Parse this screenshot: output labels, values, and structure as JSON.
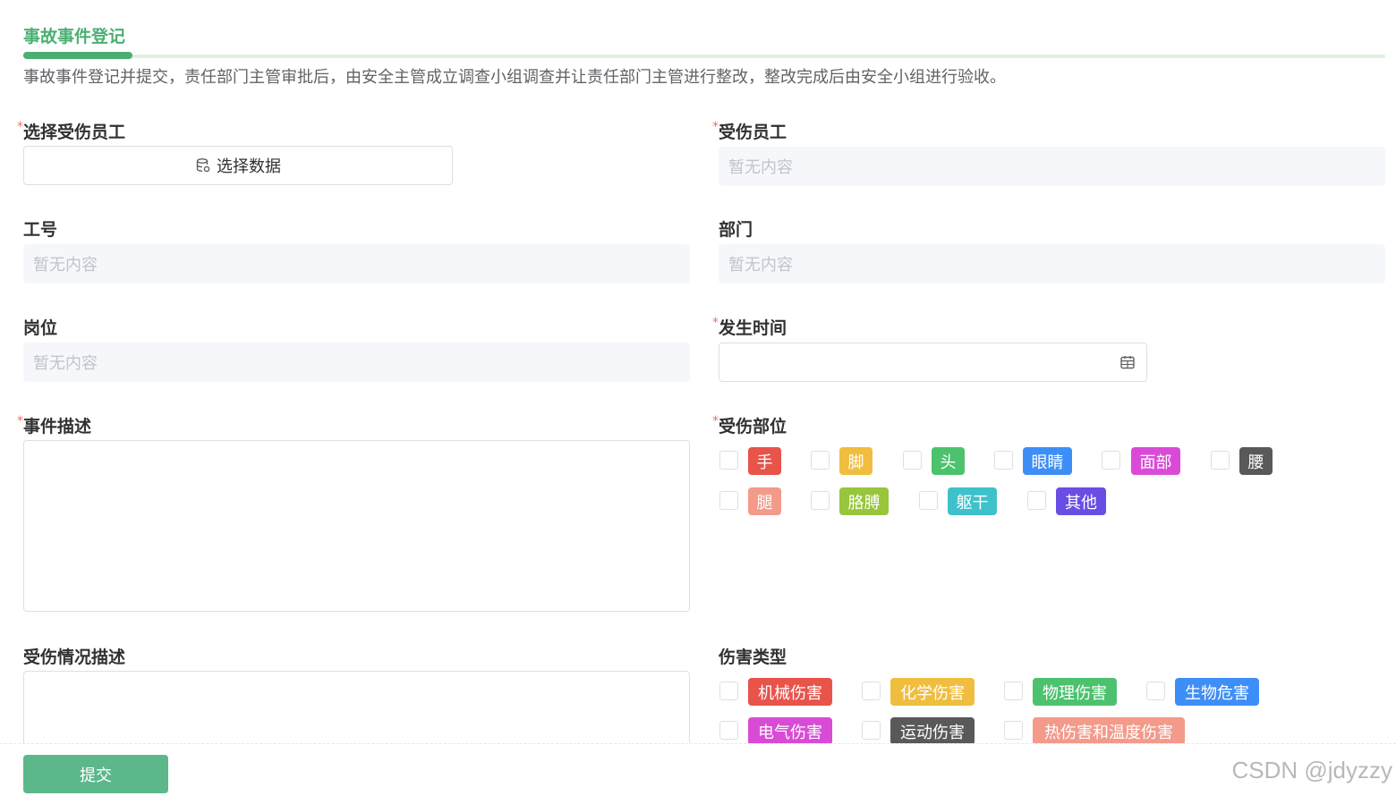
{
  "tab": {
    "title": "事故事件登记"
  },
  "intro": "事故事件登记并提交，责任部门主管审批后，由安全主管成立调查小组调查并让责任部门主管进行整改，整改完成后由安全小组进行验收。",
  "required_mark": "*",
  "fields": {
    "select_employee": {
      "label": "选择受伤员工",
      "button_label": "选择数据"
    },
    "injured_employee": {
      "label": "受伤员工",
      "value": "暂无内容"
    },
    "employee_no": {
      "label": "工号",
      "value": "暂无内容"
    },
    "department": {
      "label": "部门",
      "value": "暂无内容"
    },
    "position": {
      "label": "岗位",
      "value": "暂无内容"
    },
    "occur_time": {
      "label": "发生时间",
      "value": ""
    },
    "event_desc": {
      "label": "事件描述",
      "value": ""
    },
    "injury_part": {
      "label": "受伤部位",
      "options": [
        {
          "label": "手",
          "color": "#e8534a"
        },
        {
          "label": "脚",
          "color": "#f0bd3e"
        },
        {
          "label": "头",
          "color": "#4cc26e"
        },
        {
          "label": "眼睛",
          "color": "#3e8ef7"
        },
        {
          "label": "面部",
          "color": "#d94bd6"
        },
        {
          "label": "腰",
          "color": "#595959"
        },
        {
          "label": "腿",
          "color": "#f39a8a"
        },
        {
          "label": "胳膊",
          "color": "#97c53c"
        },
        {
          "label": "躯干",
          "color": "#3fc1cb"
        },
        {
          "label": "其他",
          "color": "#6a4de3"
        }
      ]
    },
    "injury_desc": {
      "label": "受伤情况描述",
      "value": ""
    },
    "harm_type": {
      "label": "伤害类型",
      "options": [
        {
          "label": "机械伤害",
          "color": "#e8534a"
        },
        {
          "label": "化学伤害",
          "color": "#f0bd3e"
        },
        {
          "label": "物理伤害",
          "color": "#4cc26e"
        },
        {
          "label": "生物危害",
          "color": "#3e8ef7"
        },
        {
          "label": "电气伤害",
          "color": "#d94bd6"
        },
        {
          "label": "运动伤害",
          "color": "#595959"
        },
        {
          "label": "热伤害和温度伤害",
          "color": "#f39a8a"
        }
      ]
    }
  },
  "footer": {
    "submit_label": "提交"
  },
  "watermark": "CSDN @jdyzzy",
  "icons": {
    "select_button": "database-icon",
    "date": "calendar-icon"
  },
  "colors": {
    "accent": "#4caf72",
    "submit": "#5cb88a",
    "required": "#f56c6c"
  }
}
